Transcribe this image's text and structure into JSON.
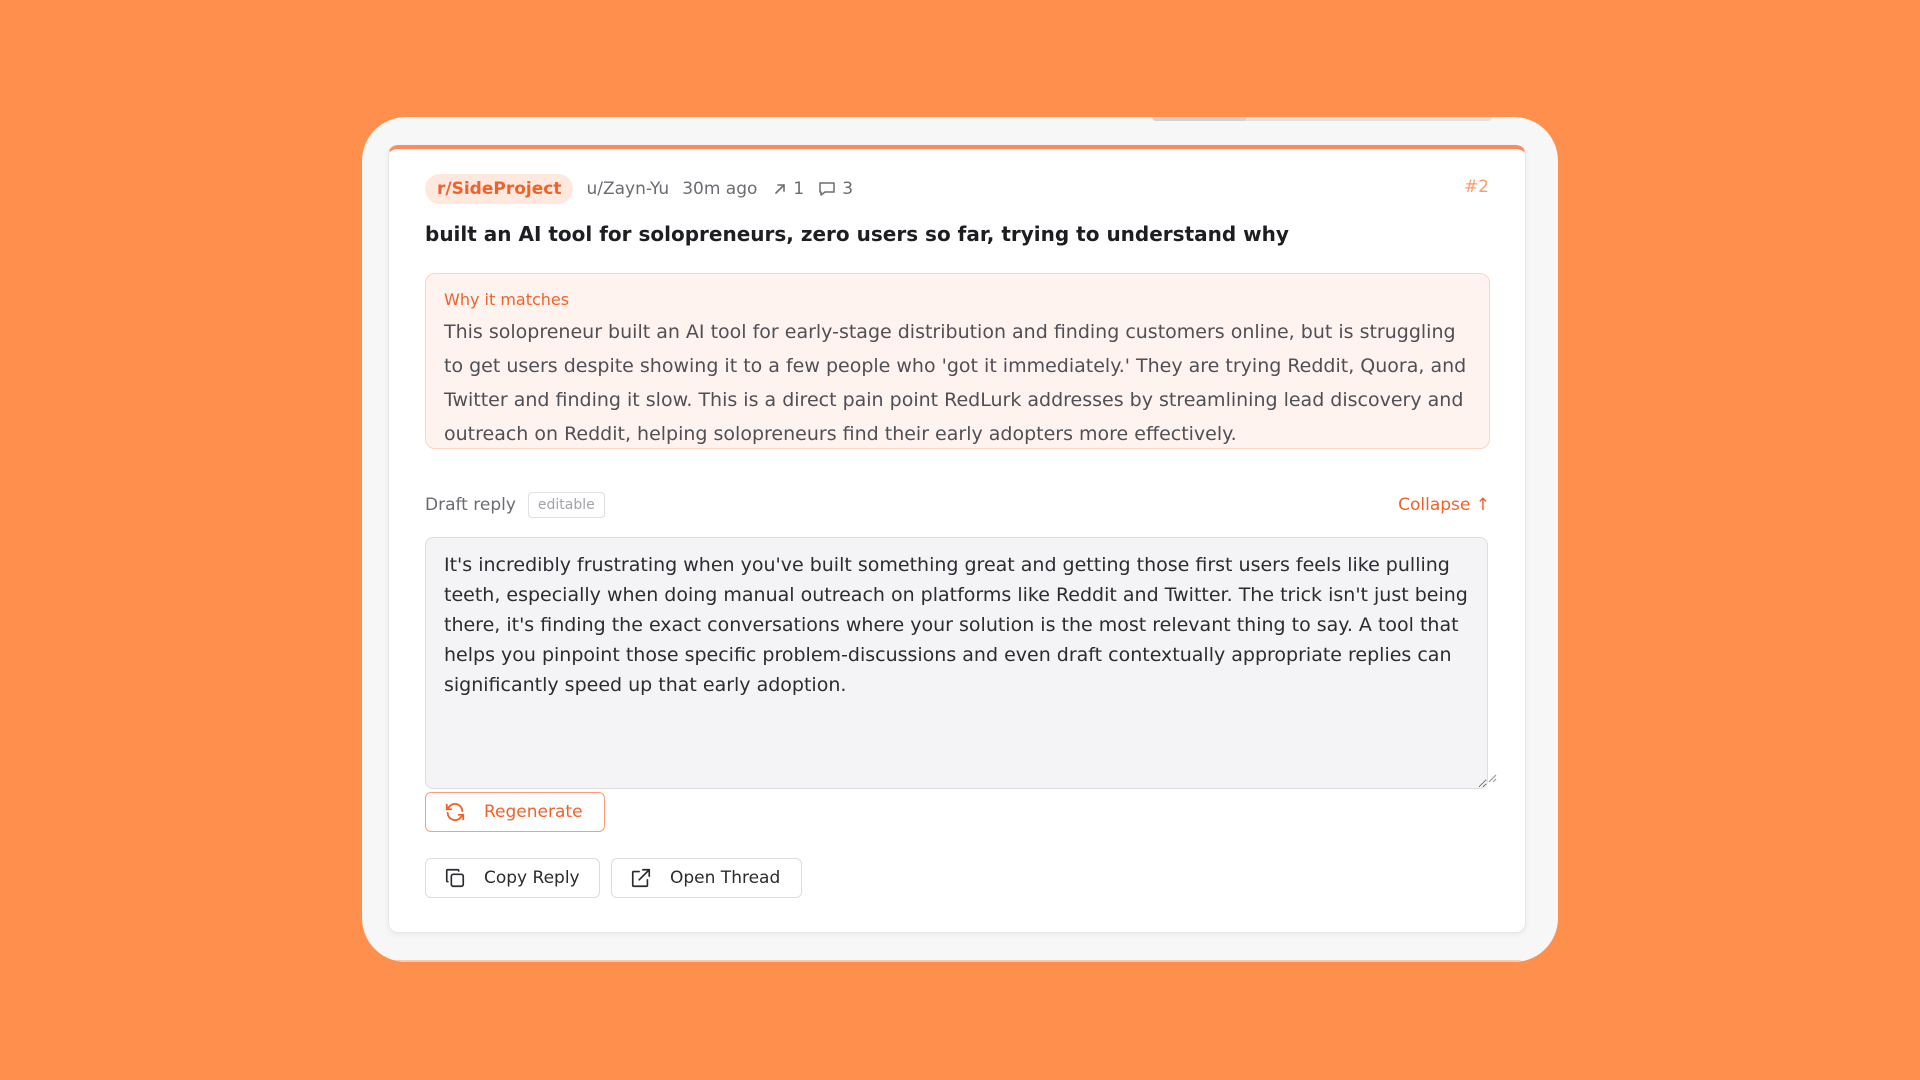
{
  "post": {
    "subreddit": "r/SideProject",
    "author": "u/Zayn-Yu",
    "time": "30m ago",
    "upvotes": "1",
    "comments": "3",
    "index": "#2",
    "title": "built an AI tool for solopreneurs, zero users so far, trying to understand why"
  },
  "match": {
    "heading": "Why it matches",
    "text": "This solopreneur built an AI tool for early-stage distribution and finding customers online, but is struggling to get users despite showing it to a few people who 'got it immediately.' They are trying Reddit, Quora, and Twitter and finding it slow. This is a direct pain point RedLurk addresses by streamlining lead discovery and outreach on Reddit, helping solopreneurs find their early adopters more effectively."
  },
  "draft": {
    "label": "Draft reply",
    "badge": "editable",
    "collapse_label": "Collapse ↑",
    "reply_text": "It's incredibly frustrating when you've built something great and getting those first users feels like pulling teeth, especially when doing manual outreach on platforms like Reddit and Twitter. The trick isn't just being there, it's finding the exact conversations where your solution is the most relevant thing to say. A tool that helps you pinpoint those specific problem-discussions and even draft contextually appropriate replies can significantly speed up that early adoption."
  },
  "actions": {
    "regenerate_label": "Regenerate",
    "copy_label": "Copy Reply",
    "open_label": "Open Thread"
  },
  "icons": {
    "upvote": "arrow-up-right-icon",
    "comments": "comment-icon",
    "regenerate": "refresh-icon",
    "copy": "copy-icon",
    "open": "external-link-icon"
  },
  "colors": {
    "background": "#FF8F4C",
    "accent": "#F0622A",
    "match_bg": "#FFF3EF"
  }
}
